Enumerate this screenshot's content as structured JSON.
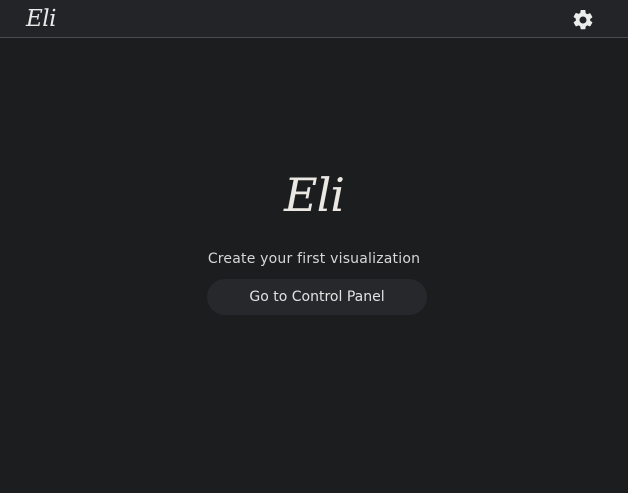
{
  "header": {
    "logo_text": "Eli",
    "settings_icon": "gear-icon"
  },
  "main": {
    "logo_text": "Eli",
    "subtitle": "Create your first visualization",
    "cta_label": "Go to Control Panel"
  },
  "colors": {
    "background": "#1c1d1f",
    "topbar": "#222427",
    "divider": "#4a4c50",
    "button": "#26282b",
    "text": "#e2e2e2"
  }
}
